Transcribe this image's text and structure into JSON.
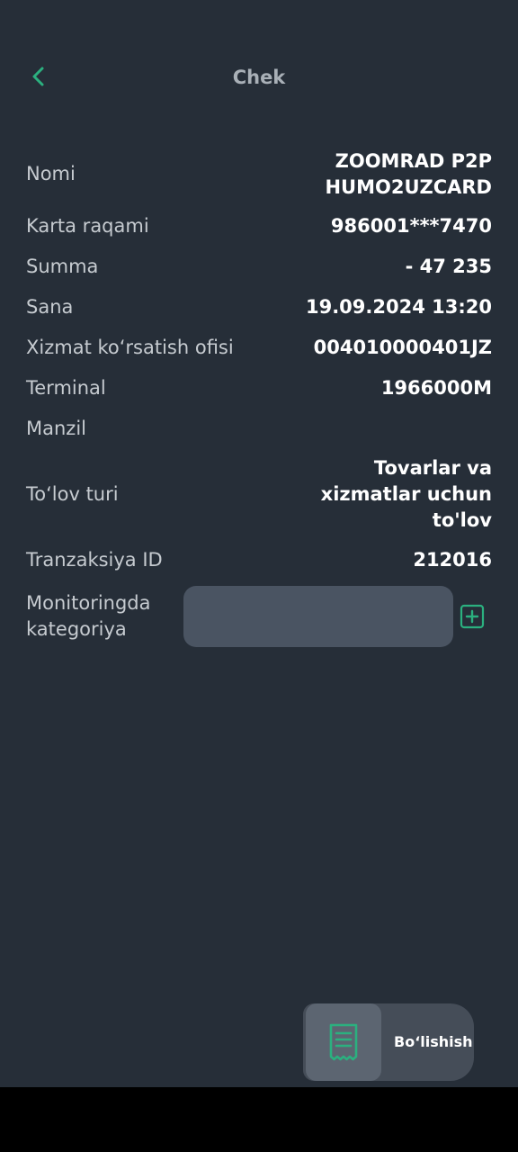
{
  "header": {
    "title": "Chek"
  },
  "details": {
    "name_label": "Nomi",
    "name_value": "ZOOMRAD P2P\nHUMO2UZCARD",
    "card_label": "Karta raqami",
    "card_value": "986001***7470",
    "amount_label": "Summa",
    "amount_value": "- 47 235",
    "date_label": "Sana",
    "date_value": "19.09.2024 13:20",
    "office_label": "Xizmat koʻrsatish ofisi",
    "office_value": "004010000401JZ",
    "terminal_label": "Terminal",
    "terminal_value": "1966000M",
    "address_label": "Manzil",
    "payment_type_label": "Toʻlov turi",
    "payment_type_value": "Tovarlar va\nxizmatlar uchun\nto'lov",
    "transaction_label": "Tranzaksiya ID",
    "transaction_value": "212016",
    "category_label": "Monitoringda\nkategoriya"
  },
  "actions": {
    "share_label": "Boʻlishish"
  },
  "colors": {
    "background": "#262e38",
    "accent": "#2bb07f",
    "input_bg": "#4a5462"
  },
  "icons": {
    "back": "chevron-left-icon",
    "add": "plus-square-icon",
    "share": "receipt-icon"
  }
}
